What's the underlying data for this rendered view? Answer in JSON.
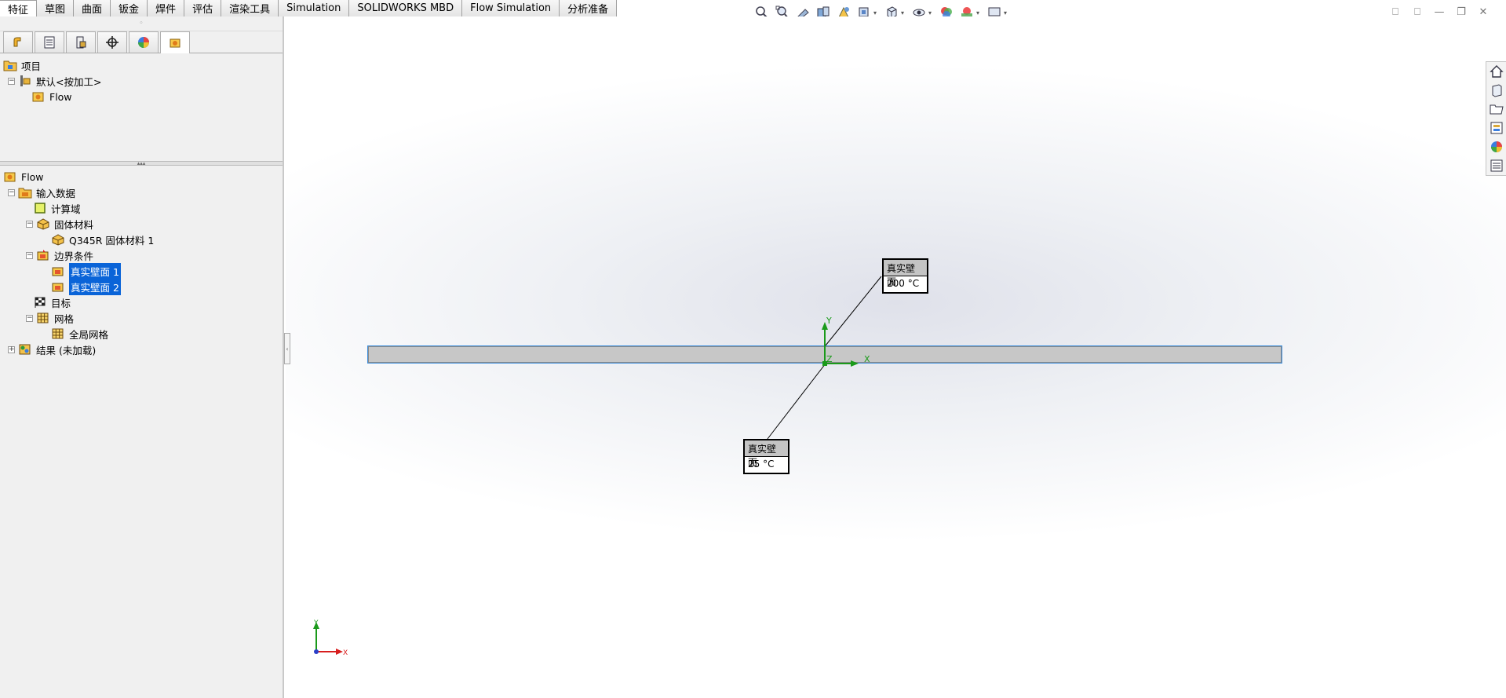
{
  "command_tabs": [
    "特征",
    "草图",
    "曲面",
    "钣金",
    "焊件",
    "评估",
    "渲染工具",
    "Simulation",
    "SOLIDWORKS MBD",
    "Flow Simulation",
    "分析准备"
  ],
  "active_tab": 0,
  "top_tree": {
    "root": "项目",
    "config": "默认<按加工>",
    "project": "Flow"
  },
  "main_tree": {
    "root": "Flow",
    "input_data": "输入数据",
    "domain": "计算域",
    "solid_materials": "固体材料",
    "solid_material_1": "Q345R 固体材料 1",
    "boundary_conditions": "边界条件",
    "real_wall_1": "真实壁面 1",
    "real_wall_2": "真实壁面 2",
    "goals": "目标",
    "mesh": "网格",
    "global_mesh": "全局网格",
    "results": "结果 (未加载)"
  },
  "callouts": {
    "top": {
      "title": "真实壁面",
      "value": "200 °C"
    },
    "bottom": {
      "title": "真实壁面",
      "value": "25 °C"
    }
  },
  "axes": {
    "x": "X",
    "y": "Y",
    "z": "Z"
  },
  "colors": {
    "selection": "#0a64d8",
    "bar_fill": "#c7c7c7",
    "bar_edge": "#3b8ddc",
    "axis_green": "#1a9a1a",
    "axis_red": "#d81e1e"
  }
}
